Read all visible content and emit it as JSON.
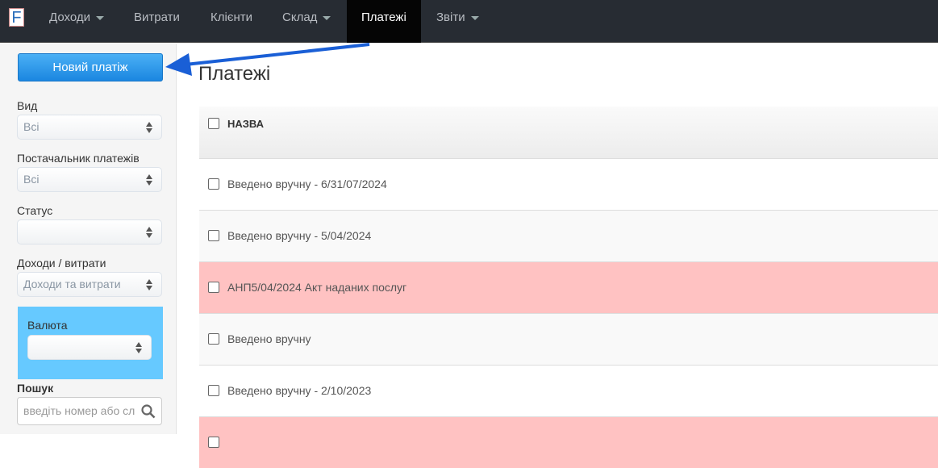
{
  "nav": {
    "logo": "F",
    "items": [
      {
        "label": "Доходи",
        "dropdown": true
      },
      {
        "label": "Витрати"
      },
      {
        "label": "Клієнти"
      },
      {
        "label": "Склад",
        "dropdown": true
      },
      {
        "label": "Платежі",
        "active": true
      },
      {
        "label": "Звіти",
        "dropdown": true
      }
    ]
  },
  "sidebar": {
    "new_button": "Новий платіж",
    "filters": {
      "vyd": {
        "label": "Вид",
        "value": "Всі"
      },
      "provider": {
        "label": "Постачальник платежів",
        "value": "Всі"
      },
      "status": {
        "label": "Статус",
        "value": ""
      },
      "income": {
        "label": "Доходи / витрати",
        "value": "Доходи та витрати"
      },
      "currency": {
        "label": "Валюта",
        "value": ""
      }
    },
    "search": {
      "label": "Пошук",
      "placeholder": "введіть номер або сл"
    }
  },
  "main": {
    "title": "Платежі",
    "column": "НАЗВА",
    "rows": [
      {
        "name": "Введено вручну - 6/31/07/2024",
        "bg": "#ffffff"
      },
      {
        "name": "Введено вручну - 5/04/2024",
        "bg": "#f9f9f9"
      },
      {
        "name": "АНП5/04/2024 Акт наданих послуг",
        "bg": "#ffc2c2"
      },
      {
        "name": "Введено вручну",
        "bg": "#f9f9f9"
      },
      {
        "name": "Введено вручну - 2/10/2023",
        "bg": "#ffffff"
      },
      {
        "name": "",
        "bg": "#ffc2c2"
      }
    ]
  },
  "colors": {
    "accent": "#1b86e0",
    "annotation_arrow": "#1a5fd6",
    "highlight": "#66c9ff"
  }
}
